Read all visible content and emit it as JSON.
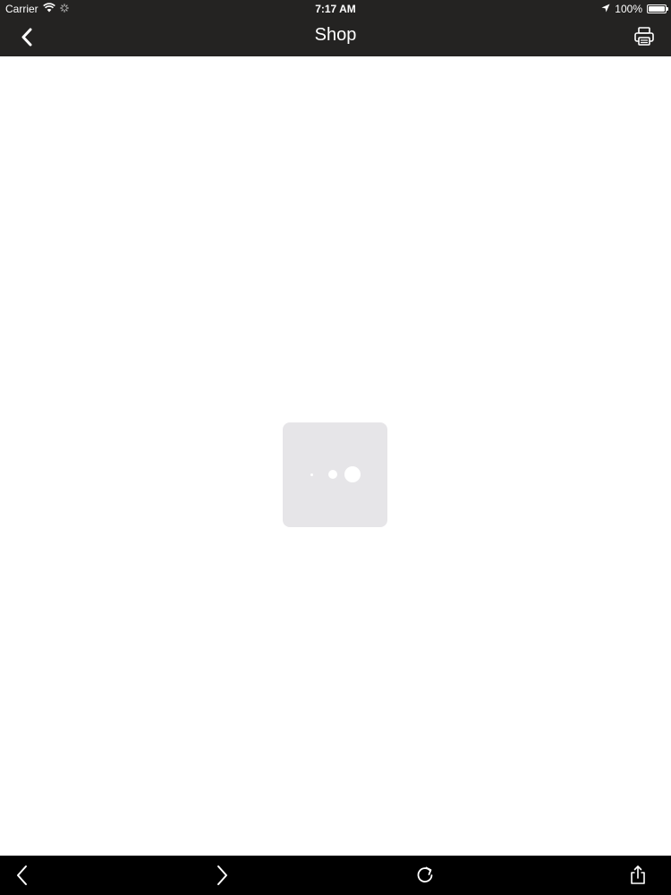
{
  "status_bar": {
    "carrier": "Carrier",
    "time": "7:17 AM",
    "battery_percent": "100%",
    "battery_level": 1.0,
    "icons": [
      "wifi-icon",
      "activity-spinner-icon",
      "location-arrow-icon",
      "battery-icon"
    ]
  },
  "nav_bar": {
    "title": "Shop",
    "left_icon": "chevron-left-icon",
    "right_icon": "printer-icon"
  },
  "loader": {
    "icon": "loading-dots-icon"
  },
  "toolbar": {
    "items": [
      "back-arrow-icon",
      "forward-arrow-icon",
      "reload-icon",
      "share-icon"
    ]
  },
  "colors": {
    "top_bar": "#242322",
    "toolbar": "#000000",
    "content_bg": "#ffffff",
    "loader_bg": "#e6e5e8",
    "foreground": "#ffffff"
  }
}
